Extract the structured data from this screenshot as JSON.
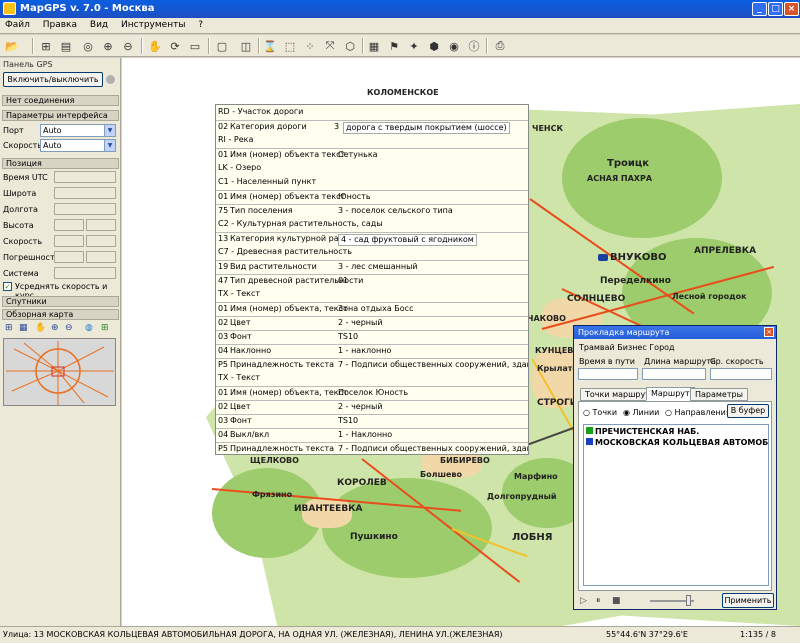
{
  "window": {
    "title": "MapGPS v. 7.0 - Москва",
    "min": "_",
    "max": "□",
    "close": "×"
  },
  "menu": [
    "Файл",
    "Правка",
    "Вид",
    "Инструменты",
    "?"
  ],
  "left": {
    "panel_title": "Панель GPS",
    "connect_button": "Включить/выключить",
    "connection_header": "Нет соединения",
    "interface_header": "Параметры интерфейса",
    "port_label": "Порт",
    "port_value": "Auto",
    "speed_label": "Скорость",
    "speed_value": "Auto",
    "position_header": "Позиция",
    "fields": [
      "Время UTC",
      "Широта",
      "Долгота",
      "Высота",
      "Скорость",
      "Погрешность",
      "Система"
    ],
    "avg_speed_label": "Усреднять скорость и курс",
    "sat_header": "Спутники",
    "overview_header": "Обзорная карта"
  },
  "info_rows": [
    {
      "t": "h",
      "a": "RD - Участок дороги"
    },
    {
      "t": "r",
      "k": "02",
      "a": "Категория дороги",
      "b": "3",
      "c": "дорога с твердым покрытием (шоссе)"
    },
    {
      "t": "h",
      "a": "RI - Река"
    },
    {
      "t": "r",
      "k": "01",
      "a": "Имя (номер) объекта текст",
      "c": "Сетунька"
    },
    {
      "t": "h",
      "a": "LK - Озеро"
    },
    {
      "t": "h",
      "a": "C1 - Населенный пункт"
    },
    {
      "t": "r",
      "k": "01",
      "a": "Имя (номер) объекта текст",
      "c": "Юность"
    },
    {
      "t": "r",
      "k": "75",
      "a": "Тип поселения",
      "c": "3 - поселок сельского типа"
    },
    {
      "t": "h",
      "a": "C2 - Культурная растительность, сады"
    },
    {
      "t": "r",
      "k": "13",
      "a": "Категория культурной растительности",
      "c": "4 - сад фруктовый с ягодником"
    },
    {
      "t": "h",
      "a": "C7 - Древесная растительность"
    },
    {
      "t": "r",
      "k": "19",
      "a": "Вид растительности",
      "c": "3 - лес смешанный"
    },
    {
      "t": "r",
      "k": "47",
      "a": "Тип древесной растительности",
      "c": "01"
    },
    {
      "t": "h",
      "a": "TX - Текст"
    },
    {
      "t": "r",
      "k": "01",
      "a": "Имя (номер) объекта, текст",
      "c": "Зона отдыха Босс"
    },
    {
      "t": "r",
      "k": "02",
      "a": "Цвет",
      "c": "2 - черный"
    },
    {
      "t": "r",
      "k": "03",
      "a": "Фонт",
      "c": "TS10"
    },
    {
      "t": "r",
      "k": "04",
      "a": "Наклонно",
      "c": "1 - наклонно"
    },
    {
      "t": "r",
      "k": "P5",
      "a": "Принадлежность текста",
      "c": "7 - Подписи общественных сооружений, зданий (?)"
    },
    {
      "t": "h",
      "a": "TX - Текст"
    },
    {
      "t": "r",
      "k": "01",
      "a": "Имя (номер) объекта, текст",
      "c": "Поселок Юность"
    },
    {
      "t": "r",
      "k": "02",
      "a": "Цвет",
      "c": "2 - черный"
    },
    {
      "t": "r",
      "k": "03",
      "a": "Фонт",
      "c": "TS10"
    },
    {
      "t": "r",
      "k": "04",
      "a": "Выкл/вкл",
      "c": "1 - Наклонно"
    },
    {
      "t": "r",
      "k": "P5",
      "a": "Принадлежность текста",
      "c": "7 - Подписи общественных сооружений, зданий (?)"
    }
  ],
  "map_labels": [
    {
      "text": "КОЛОМЕНСКОЕ"
    },
    {
      "text": "ЧЕНСК"
    },
    {
      "text": "Троицк"
    },
    {
      "text": "АСНАЯ ПАХРА"
    },
    {
      "text": "АПРЕЛЕВКА"
    },
    {
      "text": "ВНУКОВО"
    },
    {
      "text": "Переделкино"
    },
    {
      "text": "СОЛНЦЕВО"
    },
    {
      "text": "ЧАКОВО"
    },
    {
      "text": "КУНЦЕВО"
    },
    {
      "text": "Крылатское"
    },
    {
      "text": "СТРОГИНО"
    },
    {
      "text": "ЩЕЛКОВО"
    },
    {
      "text": "КОРОЛЕВ"
    },
    {
      "text": "Фрязино"
    },
    {
      "text": "ИВАНТЕЕВКА"
    },
    {
      "text": "Пушкино"
    },
    {
      "text": "ЛОБНЯ"
    },
    {
      "text": "Долгопрудный"
    },
    {
      "text": "Болшево"
    },
    {
      "text": "Марфино"
    },
    {
      "text": "БИБИРЕВО"
    },
    {
      "text": "Лесной городок"
    }
  ],
  "route": {
    "title": "Прокладка маршрута",
    "name": "Трамвай Бизнес Город",
    "col_time": "Время в пути",
    "col_len": "Длина маршрута",
    "col_speed": "Ср. скорость",
    "tabs": [
      "Точки маршрута",
      "Маршрут",
      "Параметры"
    ],
    "radio": [
      "Точки",
      "Линии",
      "Направления"
    ],
    "to_buffer": "В буфер",
    "items": [
      "ПРЕЧИСТЕНСКАЯ НАБ.",
      "МОСКОВСКАЯ КОЛЬЦЕВАЯ АВТОМОБ"
    ],
    "apply": "Применить"
  },
  "status": {
    "left": "Улица: 13 МОСКОВСКАЯ КОЛЬЦЕВАЯ АВТОМОБИЛЬНАЯ ДОРОГА, НА ОДНАЯ УЛ. (ЖЕЛЕЗНАЯ), ЛЕНИНА УЛ.(ЖЕЛЕЗНАЯ)",
    "coords": "55°44.6'N 37°29.6'E",
    "scale": "1:135 / 8"
  },
  "colors": {
    "title_blue": "#0a5fe0",
    "road": "#e84e1c",
    "forest": "#9ccc6c"
  }
}
